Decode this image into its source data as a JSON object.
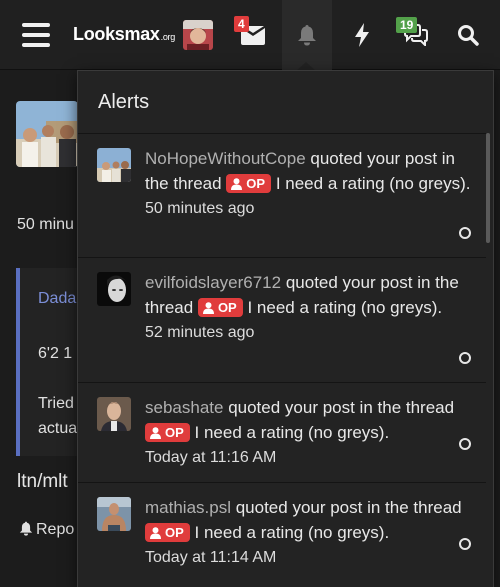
{
  "nav": {
    "logo_main": "Looksmax",
    "logo_suffix": ".org",
    "inbox_count": "4",
    "conversations_count": "19"
  },
  "background": {
    "time": "50 minu",
    "quote_user": "Dada",
    "line1": "6'2 1",
    "line2": "Tried",
    "line3": "actua",
    "heading": "ltn/mlt",
    "report": "Repo"
  },
  "alerts": {
    "title": "Alerts",
    "items": [
      {
        "user": "NoHopeWithoutCope",
        "action": "quoted your post in the thread",
        "op": "OP",
        "thread": "I need a rating (no greys).",
        "time": "50 minutes ago"
      },
      {
        "user": "evilfoidslayer6712",
        "action": "quoted your post in the thread",
        "op": "OP",
        "thread": "I need a rating (no greys).",
        "time": "52 minutes ago"
      },
      {
        "user": "sebashate",
        "action": "quoted your post in the thread",
        "op": "OP",
        "thread": "I need a rating (no greys).",
        "time": "Today at 11:16 AM"
      },
      {
        "user": "mathias.psl",
        "action": "quoted your post in the thread",
        "op": "OP",
        "thread": "I need a rating (no greys).",
        "time": "Today at 11:14 AM"
      }
    ]
  },
  "colors": {
    "background": "#1c1c1c",
    "topbar": "#202020",
    "panel": "#232323",
    "op_badge": "#e03c3c",
    "unread_badge": "#e03c3c",
    "conversation_badge": "#53a14a",
    "quote_accent": "#5a6fc0"
  },
  "icons": {
    "menu": "hamburger-icon",
    "inbox": "envelope-icon",
    "alerts": "bell-icon",
    "whats_new": "lightning-icon",
    "conversations": "chat-bubbles-icon",
    "search": "search-icon",
    "op": "user-icon",
    "read_status": "circle-icon",
    "report": "bell-icon"
  }
}
